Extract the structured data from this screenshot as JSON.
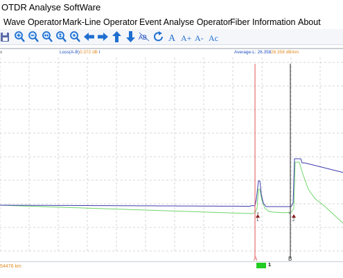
{
  "window": {
    "title": "OTDR Analyse SoftWare"
  },
  "menu": {
    "items": [
      "Wave Operator",
      "Mark-Line Operator",
      "Event Analyse Operator",
      "Fiber Information",
      "About"
    ]
  },
  "toolbar": {
    "icons": [
      "save-icon",
      "zoom-in-icon",
      "zoom-out-icon",
      "zoom-in-horizontal-icon",
      "zoom-out-horizontal-icon",
      "zoom-reset-icon",
      "arrow-left-icon",
      "arrow-right-icon",
      "arrow-up-icon",
      "arrow-down-icon",
      "ab-marker-icon",
      "refresh-icon"
    ],
    "font_buttons": [
      "A",
      "A+",
      "A-",
      "Ac"
    ]
  },
  "plot": {
    "y_unit_partial": "v",
    "loss_ab": "Loss(A-B): 0.372 dB",
    "average_loss": "Average-L: 26.358 dB/km",
    "marker_a_label": "A",
    "marker_b_label": "B",
    "event_1_label": "1",
    "event_2_label": "2"
  },
  "status": {
    "distance": "54476 km",
    "fiber_index": "1"
  },
  "colors": {
    "trace_blue": "#3b3bb0",
    "trace_green": "#6fd66a",
    "marker_a": "#e05050",
    "marker_b": "#222222",
    "loss_text": "#1f4fbf",
    "value_text": "#e08a20",
    "status_indicator": "#22cc22"
  }
}
